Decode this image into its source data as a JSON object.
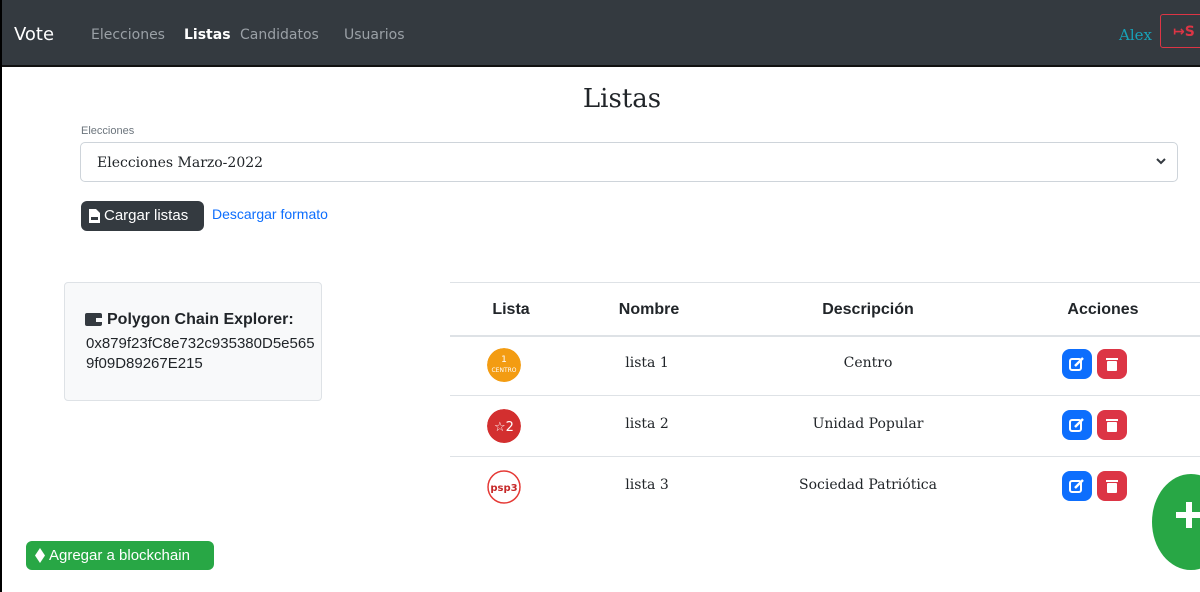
{
  "navbar": {
    "brand": "Vote",
    "links": [
      "Elecciones",
      "Listas",
      "Candidatos",
      "Usuarios"
    ],
    "active": "Listas",
    "user": "Alex",
    "logout_label": "S"
  },
  "page": {
    "title": "Listas",
    "select_label": "Elecciones",
    "select_value": "Elecciones Marzo-2022",
    "upload_label": "Cargar listas",
    "download_label": "Descargar formato"
  },
  "explorer": {
    "title": "Polygon Chain Explorer:",
    "address": "0x879f23fC8e732c935380D5e5659f09D89267E215"
  },
  "table": {
    "headers": [
      "Lista",
      "Nombre",
      "Descripción",
      "Acciones"
    ],
    "rows": [
      {
        "logo": "centro-logo",
        "nombre": "lista 1",
        "descripcion": "Centro"
      },
      {
        "logo": "unidad-popular-logo",
        "nombre": "lista 2",
        "descripcion": "Unidad Popular"
      },
      {
        "logo": "psp-logo",
        "nombre": "lista 3",
        "descripcion": "Sociedad Patriótica"
      }
    ]
  },
  "actions": {
    "blockchain_label": "Agregar a blockchain",
    "fab_icon": "plus-icon"
  },
  "colors": {
    "navbar": "#343a40",
    "primary": "#0d6efd",
    "danger": "#dc3545",
    "success": "#28a745",
    "info": "#17a2b8"
  }
}
